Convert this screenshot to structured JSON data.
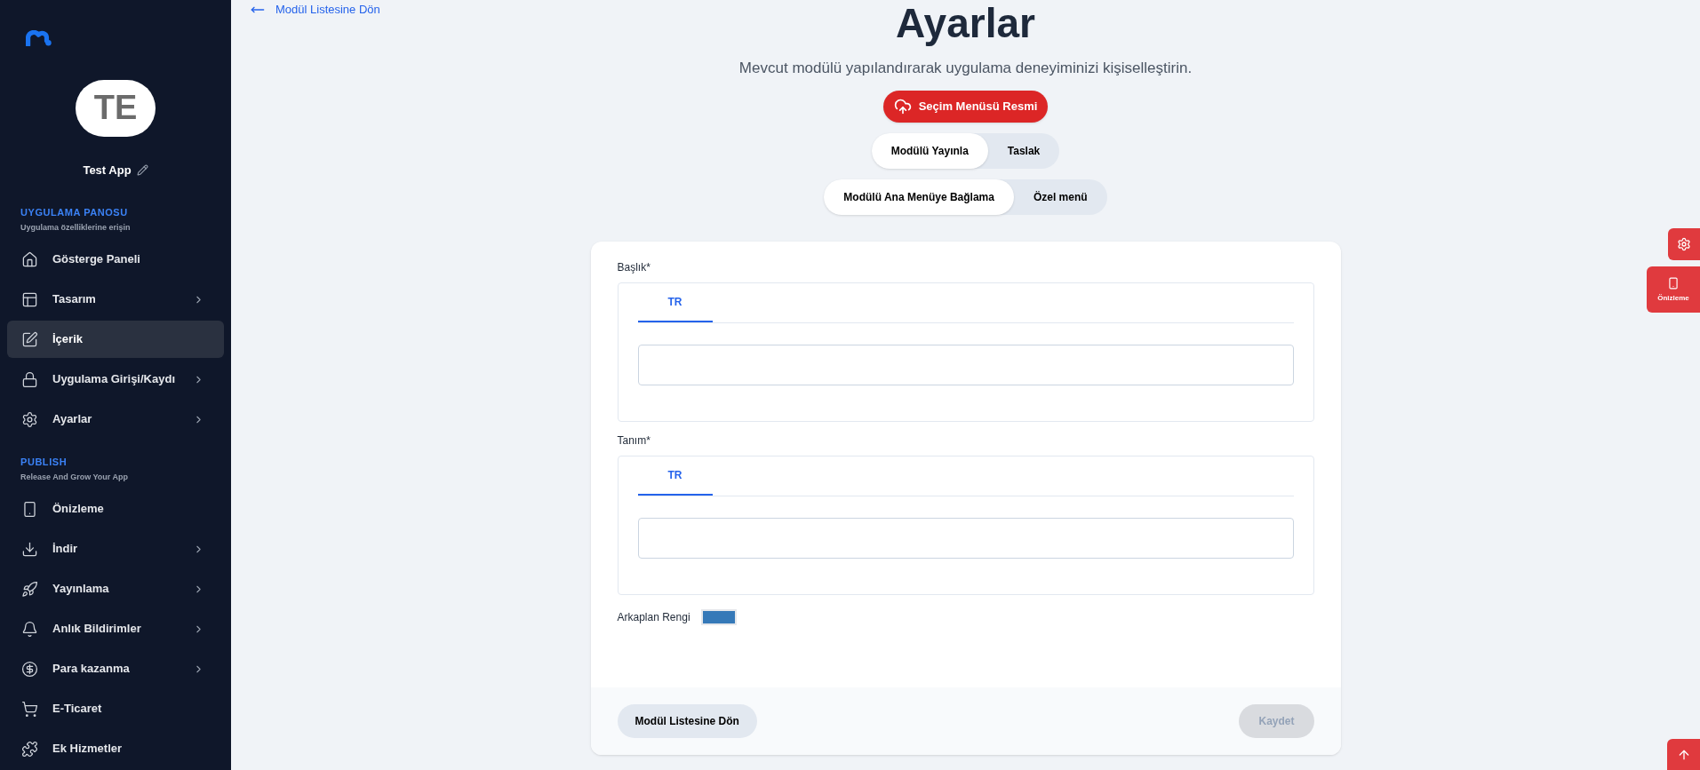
{
  "sidebar": {
    "app_name": "Test App",
    "avatar_initials": "TE",
    "sections": [
      {
        "title": "UYGULAMA PANOSU",
        "subtitle": "Uygulama özelliklerine erişin",
        "items": [
          {
            "label": "Gösterge Paneli",
            "expandable": false,
            "selected": false
          },
          {
            "label": "Tasarım",
            "expandable": true,
            "selected": false
          },
          {
            "label": "İçerik",
            "expandable": false,
            "selected": true
          },
          {
            "label": "Uygulama Girişi/Kaydı",
            "expandable": true,
            "selected": false
          },
          {
            "label": "Ayarlar",
            "expandable": true,
            "selected": false
          }
        ]
      },
      {
        "title": "PUBLISH",
        "subtitle": "Release And Grow Your App",
        "items": [
          {
            "label": "Önizleme",
            "expandable": false,
            "selected": false
          },
          {
            "label": "İndir",
            "expandable": true,
            "selected": false
          },
          {
            "label": "Yayınlama",
            "expandable": true,
            "selected": false
          },
          {
            "label": "Anlık Bildirimler",
            "expandable": true,
            "selected": false
          },
          {
            "label": "Para kazanma",
            "expandable": true,
            "selected": false
          },
          {
            "label": "E-Ticaret",
            "expandable": false,
            "selected": false
          },
          {
            "label": "Ek Hizmetler",
            "expandable": false,
            "selected": false
          }
        ]
      }
    ]
  },
  "back_link": "Modül Listesine Dön",
  "title": "Ayarlar",
  "subtitle": "Mevcut modülü yapılandırarak uygulama deneyiminizi kişiselleştirin.",
  "upload_button": "Seçim Menüsü Resmi",
  "toggle_groups": [
    [
      {
        "label": "Modülü Yayınla",
        "selected": true
      },
      {
        "label": "Taslak",
        "selected": false
      }
    ],
    [
      {
        "label": "Modülü Ana Menüye Bağlama",
        "selected": true
      },
      {
        "label": "Özel menü",
        "selected": false
      }
    ]
  ],
  "form": {
    "fields": [
      {
        "label": "Başlık*",
        "tabs": [
          {
            "label": "TR",
            "selected": true
          }
        ]
      },
      {
        "label": "Tanım*",
        "tabs": [
          {
            "label": "TR",
            "selected": true
          }
        ]
      }
    ],
    "color_field": {
      "label": "Arkaplan Rengi",
      "color": "#3579b8"
    },
    "back_button": "Modül Listesine Dön",
    "save_button": {
      "label": "Kaydet",
      "disabled": true
    }
  },
  "floating": {
    "preview_label": "Önizleme"
  }
}
